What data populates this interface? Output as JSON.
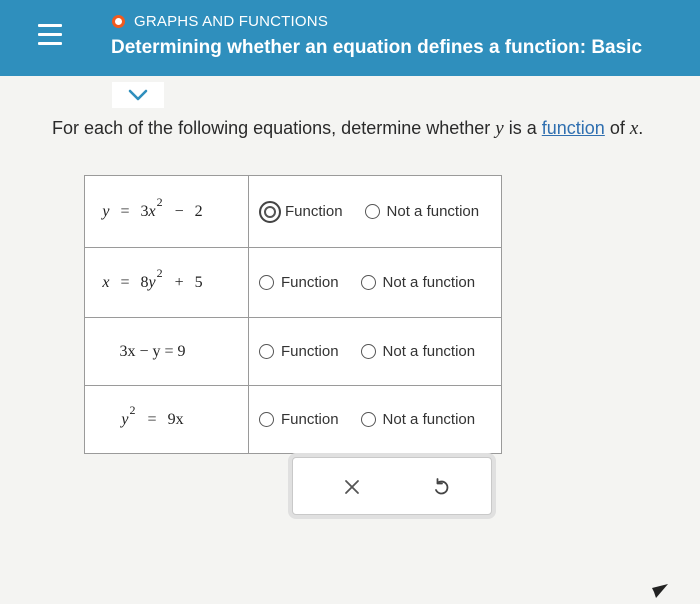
{
  "header": {
    "topic": "GRAPHS AND FUNCTIONS",
    "title": "Determining whether an equation defines a function: Basic",
    "menu_icon": "hamburger-menu-icon",
    "topic_icon": "status-circle-icon",
    "colors": {
      "header_bg": "#2f8fbd",
      "topic_dot": "#f05a1f",
      "link": "#2f6fb0"
    }
  },
  "expand_icon": "chevron-down-icon",
  "prompt": {
    "part1": "For each of the following equations, determine whether",
    "var_y": "y",
    "part2": "is a",
    "link": "function",
    "part3": "of",
    "var_x": "x",
    "end": "."
  },
  "equations": [
    {
      "lhs": "y",
      "eq": "=",
      "coef": "3",
      "base": "x",
      "exp": "2",
      "op": "−",
      "const": "2"
    },
    {
      "lhs": "x",
      "eq": "=",
      "coef": "8",
      "base": "y",
      "exp": "2",
      "op": "+",
      "const": "5"
    },
    {
      "text": "3x − y = 9"
    },
    {
      "base": "y",
      "exp": "2",
      "eq": "=",
      "rhs": "9x"
    }
  ],
  "options": {
    "function_label": "Function",
    "not_function_label": "Not a function"
  },
  "answers": [
    "Function",
    null,
    null,
    null
  ],
  "actions": {
    "clear_icon": "x-icon",
    "undo_icon": "undo-icon"
  }
}
